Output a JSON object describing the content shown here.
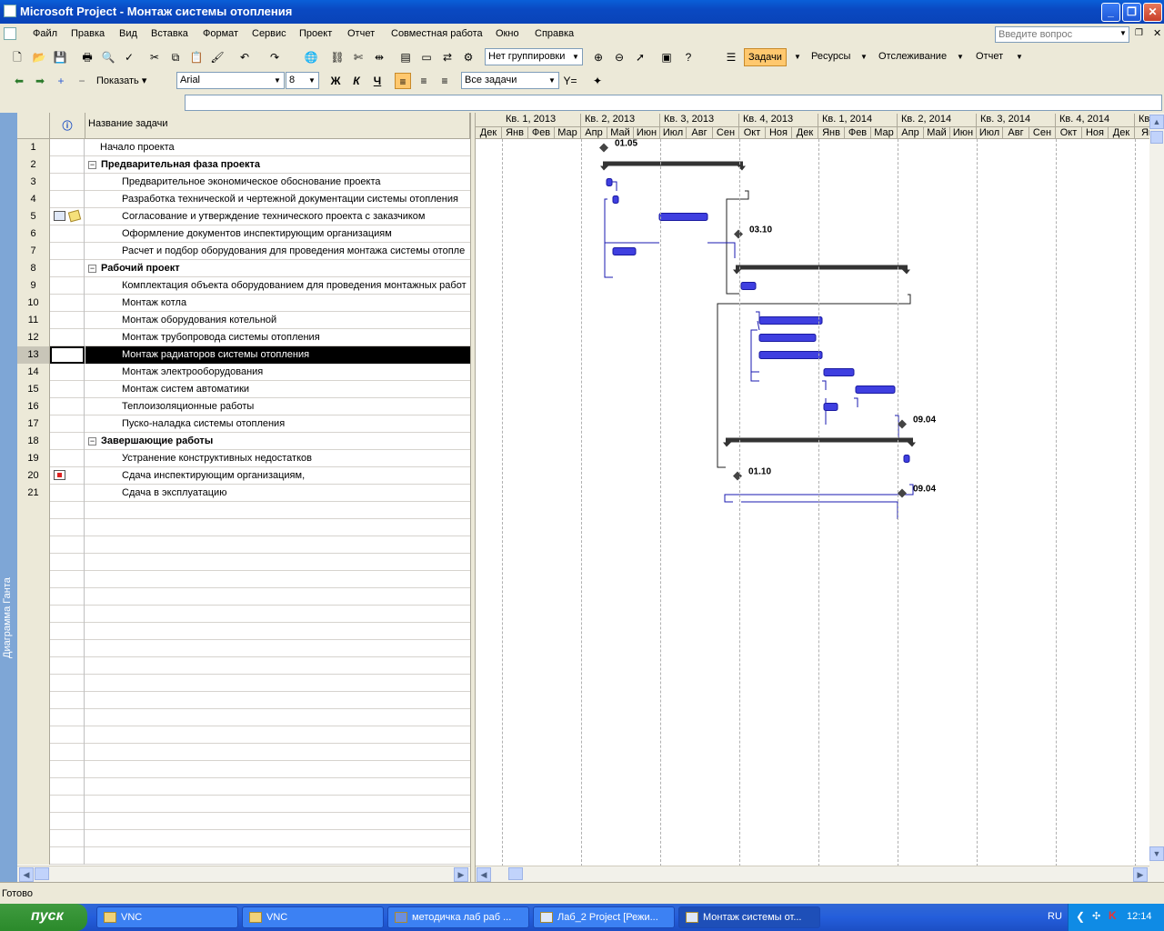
{
  "window": {
    "title": "Microsoft Project - Монтаж системы отопления",
    "buttons": [
      "_",
      "❐",
      "✕"
    ]
  },
  "menu": {
    "items": [
      "Файл",
      "Правка",
      "Вид",
      "Вставка",
      "Формат",
      "Сервис",
      "Проект",
      "Отчет",
      "Совместная работа",
      "Окно",
      "Справка"
    ],
    "ask_placeholder": "Введите вопрос"
  },
  "toolbar1": {
    "grouping": "Нет группировки",
    "tabs": [
      "Задачи",
      "Ресурсы",
      "Отслеживание",
      "Отчет"
    ],
    "active_tab": "Задачи"
  },
  "toolbar2": {
    "show_label": "Показать",
    "font": "Arial",
    "font_size": "8",
    "bold": "Ж",
    "italic": "К",
    "underline": "Ч",
    "filter": "Все задачи"
  },
  "viewbar": {
    "label": "Диаграмма Ганта"
  },
  "table": {
    "header_name": "Название задачи",
    "rows": [
      {
        "id": "1",
        "name": "Начало проекта",
        "level": 0,
        "summary": false
      },
      {
        "id": "2",
        "name": "Предварительная фаза проекта",
        "level": 0,
        "summary": true
      },
      {
        "id": "3",
        "name": "Предварительное экономическое обоснование проекта",
        "level": 1,
        "summary": false
      },
      {
        "id": "4",
        "name": "Разработка технической и чертежной документации системы отопления",
        "level": 1,
        "summary": false
      },
      {
        "id": "5",
        "name": "Согласование и утверждение технического проекта с заказчиком",
        "level": 1,
        "summary": false
      },
      {
        "id": "6",
        "name": "Оформление документов инспектирующим организациям",
        "level": 1,
        "summary": false
      },
      {
        "id": "7",
        "name": "Расчет и подбор оборудования для проведения монтажа системы отопле",
        "level": 1,
        "summary": false
      },
      {
        "id": "8",
        "name": "Рабочий проект",
        "level": 0,
        "summary": true
      },
      {
        "id": "9",
        "name": "Комплектация объекта оборудованием для проведения монтажных работ",
        "level": 1,
        "summary": false
      },
      {
        "id": "10",
        "name": "Монтаж котла",
        "level": 1,
        "summary": false
      },
      {
        "id": "11",
        "name": "Монтаж оборудования котельной",
        "level": 1,
        "summary": false
      },
      {
        "id": "12",
        "name": "Монтаж трубопровода системы отопления",
        "level": 1,
        "summary": false
      },
      {
        "id": "13",
        "name": "Монтаж радиаторов системы отопления",
        "level": 1,
        "summary": false
      },
      {
        "id": "14",
        "name": "Монтаж электрооборудования",
        "level": 1,
        "summary": false
      },
      {
        "id": "15",
        "name": "Монтаж систем автоматики",
        "level": 1,
        "summary": false
      },
      {
        "id": "16",
        "name": "Теплоизоляционные работы",
        "level": 1,
        "summary": false
      },
      {
        "id": "17",
        "name": "Пуско-наладка системы отопления",
        "level": 1,
        "summary": false
      },
      {
        "id": "18",
        "name": "Завершающие работы",
        "level": 0,
        "summary": true
      },
      {
        "id": "19",
        "name": "Устранение конструктивных недостатков",
        "level": 1,
        "summary": false
      },
      {
        "id": "20",
        "name": "Сдача инспектирующим организациям,",
        "level": 1,
        "summary": false
      },
      {
        "id": "21",
        "name": "Сдача в эксплуатацию",
        "level": 1,
        "summary": false
      }
    ],
    "selected_row": "13"
  },
  "gantt": {
    "quarters": [
      "Кв. 1, 2013",
      "Кв. 2, 2013",
      "Кв. 3, 2013",
      "Кв. 4, 2013",
      "Кв. 1, 2014",
      "Кв. 2, 2014",
      "Кв. 3, 2014",
      "Кв. 4, 2014",
      "Кв"
    ],
    "months": [
      "Дек",
      "Янв",
      "Фев",
      "Мар",
      "Апр",
      "Май",
      "Июн",
      "Июл",
      "Авг",
      "Сен",
      "Окт",
      "Ноя",
      "Дек",
      "Янв",
      "Фев",
      "Мар",
      "Апр",
      "Май",
      "Июн",
      "Июл",
      "Авг",
      "Сен",
      "Окт",
      "Ноя",
      "Дек",
      "Ян"
    ],
    "milestone_labels": [
      "01.05",
      "03.10",
      "09.04",
      "01.10",
      "09.04"
    ],
    "bar_color": "#3f3fe0"
  },
  "status": {
    "text": "Готово"
  },
  "taskbar": {
    "start": "пуск",
    "tasks": [
      "VNC",
      "VNC",
      "методичка лаб раб ...",
      "Лаб_2 Project [Режи...",
      "Монтаж системы от..."
    ],
    "lang": "RU",
    "clock": "12:14"
  }
}
